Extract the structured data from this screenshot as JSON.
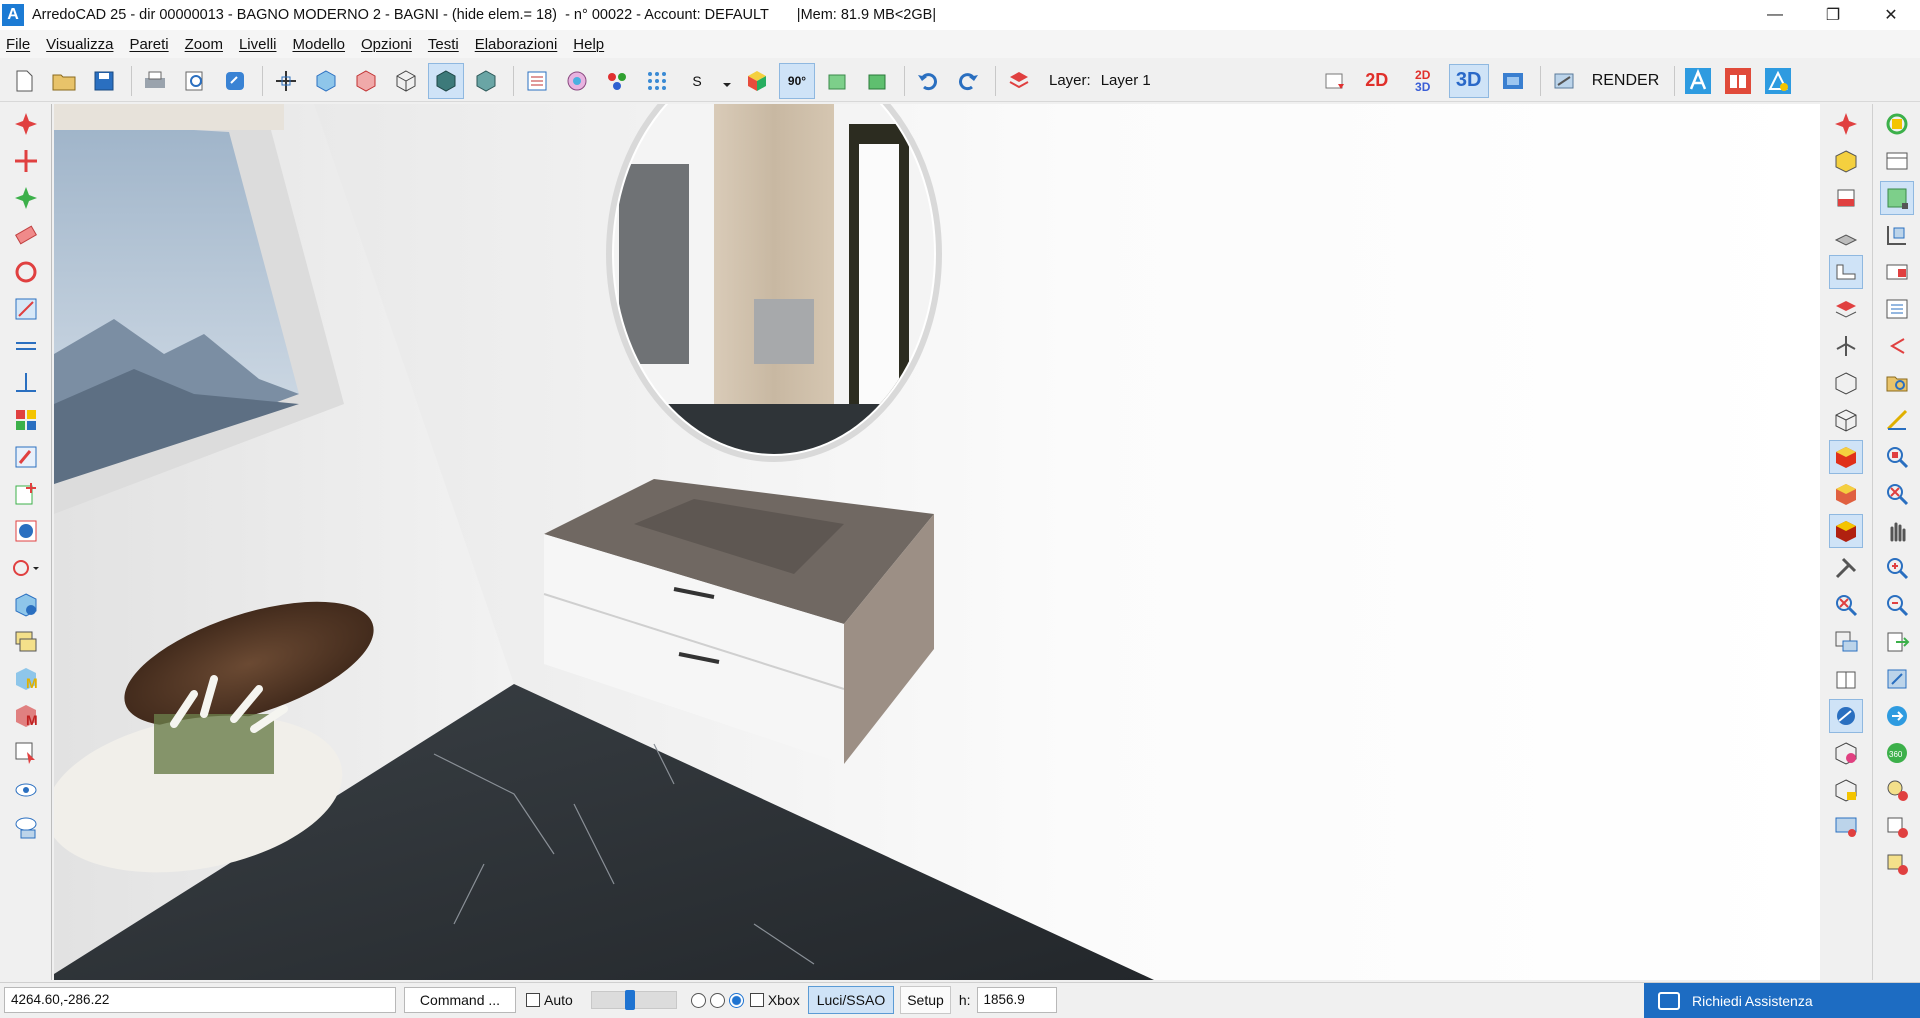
{
  "window": {
    "title": "ArredoCAD 25 - dir 00000013 - BAGNO MODERNO 2 - BAGNI - (hide elem.= 18)  - n° 00022 - Account: DEFAULT       |Mem: 81.9 MB<2GB|",
    "logo_letter": "A",
    "minimize": "—",
    "restore": "❐",
    "close": "✕"
  },
  "menu": [
    "File",
    "Visualizza",
    "Pareti",
    "Zoom",
    "Livelli",
    "Modello",
    "Opzioni",
    "Testi",
    "Elaborazioni",
    "Help"
  ],
  "toolbar": {
    "s_label": "S",
    "angle_label": "90°",
    "layer_label": "Layer:",
    "layer_value": "Layer 1",
    "mode_2d": "2D",
    "mode_2d3d_top": "2D",
    "mode_2d3d_bottom": "3D",
    "mode_3d": "3D",
    "render_label": "RENDER"
  },
  "statusbar": {
    "coordinates": "4264.60,-286.22",
    "command_button": "Command ...",
    "auto_label": "Auto",
    "xbox_label": "Xbox",
    "luci_button": "Luci/SSAO",
    "setup_button": "Setup",
    "h_label": "h:",
    "h_value": "1856.9",
    "slider_level": 0.45,
    "assist_button": "Richiedi Assistenza"
  },
  "colors": {
    "accent": "#1d6cc2",
    "active_bg": "#cfe3f7",
    "mode_2d": "#e0302b",
    "mode_3d": "#2a68c8"
  }
}
